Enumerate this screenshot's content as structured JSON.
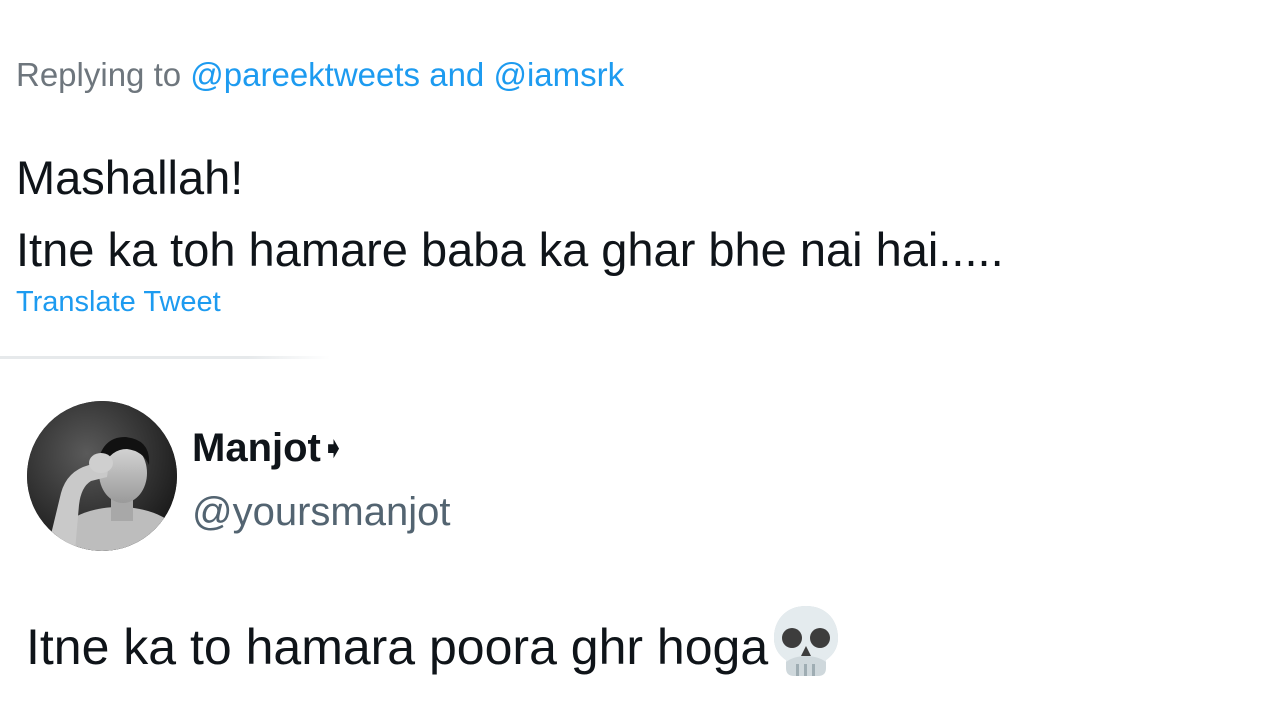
{
  "reply_context": {
    "prefix": "Replying to ",
    "mention_1": "@pareektweets",
    "conjunction": " and ",
    "mention_2": "@iamsrk"
  },
  "tweet": {
    "line_1": "Mashallah!",
    "line_2": "Itne ka toh hamare baba ka ghar bhe nai hai.....",
    "translate_label": "Translate Tweet"
  },
  "reply": {
    "display_name": "Manjot",
    "name_emoji": "➧",
    "handle": "@yoursmanjot",
    "text": "Itne ka to hamara poora ghr hoga",
    "emoji_icon": "skull-icon"
  },
  "colors": {
    "link": "#1d9bf0",
    "muted": "#6e767d",
    "text": "#0f1419",
    "handle": "#536471"
  }
}
